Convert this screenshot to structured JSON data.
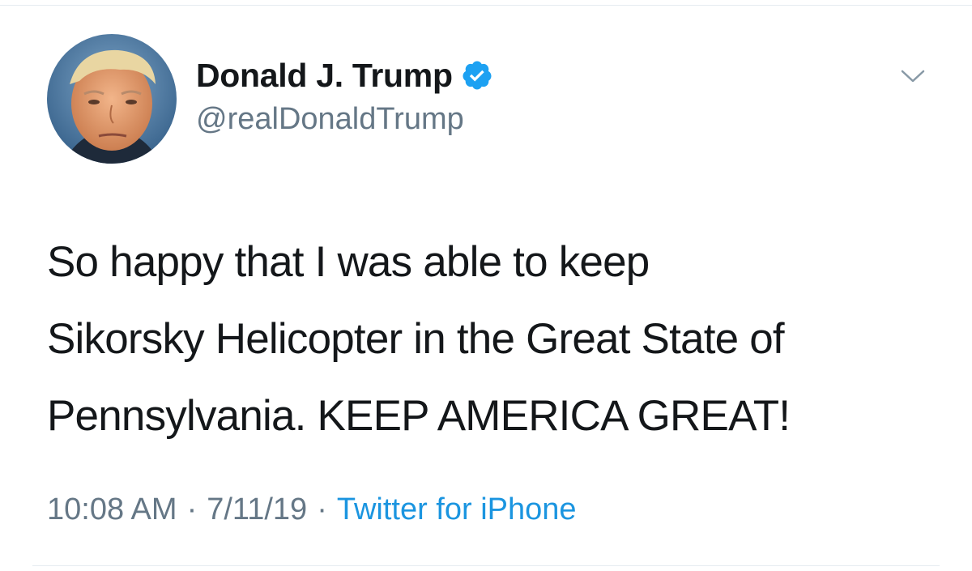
{
  "tweet": {
    "author": {
      "display_name": "Donald J. Trump",
      "handle": "@realDonaldTrump",
      "verified": true
    },
    "text": "So happy that I was able to keep\nSikorsky Helicopter in the Great State of\nPennsylvania. KEEP AMERICA GREAT!",
    "meta": {
      "time": "10:08 AM",
      "separator": "·",
      "date": "7/11/19",
      "source": "Twitter for iPhone"
    }
  },
  "icons": {
    "verified": "verified-badge-icon",
    "caret": "chevron-down-icon"
  },
  "colors": {
    "verified_blue": "#1da1f2",
    "link_blue": "#1b95e0",
    "secondary_text": "#657786",
    "primary_text": "#14171a"
  }
}
